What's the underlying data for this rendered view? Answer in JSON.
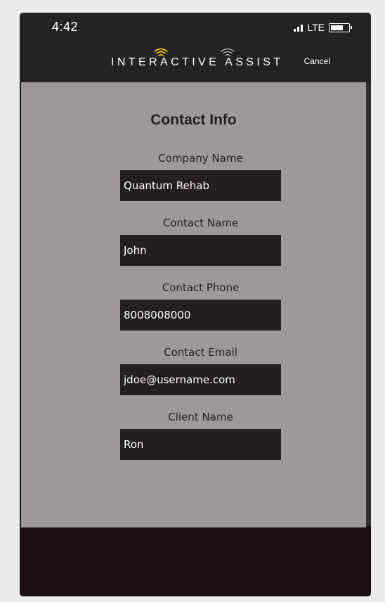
{
  "status_bar": {
    "time": "4:42",
    "network": "LTE",
    "battery_level": 0.6,
    "signal_icon": "signal-bars-icon",
    "battery_icon": "battery-icon"
  },
  "header": {
    "logo_text": "INTERACTIVE ASSIST",
    "logo_icon": "wifi-arc-icon",
    "logo_accent_color": "#f0c419",
    "logo_secondary_color": "#bdbdbd",
    "cancel_label": "Cancel"
  },
  "form": {
    "title": "Contact Info",
    "fields": [
      {
        "label": "Company Name",
        "value": "Quantum Rehab"
      },
      {
        "label": "Contact Name",
        "value": "John"
      },
      {
        "label": "Contact Phone",
        "value": "8008008000"
      },
      {
        "label": "Contact Email",
        "value": "jdoe@username.com"
      },
      {
        "label": "Client Name",
        "value": "Ron"
      }
    ]
  },
  "colors": {
    "header_bg": "#232323",
    "content_bg": "#9d999a",
    "input_bg": "#231f20",
    "input_text": "#ffffff",
    "label_text": "#231f20",
    "footer_bg": "#1b0e10"
  }
}
